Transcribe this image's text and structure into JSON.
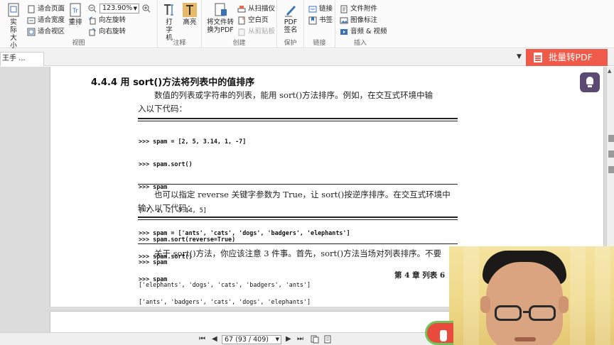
{
  "ribbon": {
    "view": {
      "actual_size": "实际大小",
      "fit_page": "适合页面",
      "fit_width": "适合宽度",
      "fit_view": "适合视区",
      "reflow": "重排",
      "zoom": "123.90%",
      "rotate_left": "向左旋转",
      "rotate_right": "向右旋转",
      "label": "视图"
    },
    "annotate": {
      "typewriter": "打字机",
      "highlight": "高亮",
      "label": "注释"
    },
    "create": {
      "convert": "将文件转换为PDF",
      "from_scanner": "从扫描仪",
      "blank_page": "空白页",
      "from_clipboard": "从剪贴板",
      "label": "创建"
    },
    "protect": {
      "pdf_sign": "PDF签名",
      "label": "保护"
    },
    "links": {
      "link": "链接",
      "bookmark": "书签",
      "label": "链接"
    },
    "insert": {
      "attachment": "文件附件",
      "image_annot": "图像标注",
      "audio_video": "音频 & 视频",
      "label": "插入"
    }
  },
  "tabs": {
    "doc_tab": "王手 ..."
  },
  "batch_pdf": "批量转PDF",
  "document": {
    "section_title": "4.4.4   用 sort()方法将列表中的值排序",
    "para1_line1": "数值的列表或字符串的列表，能用 sort()方法排序。例如，在交互式环境中输",
    "para1_line2": "入以下代码：",
    "code1": [
      ">>> spam = [2, 5, 3.14, 1, -7]",
      ">>> spam.sort()",
      ">>> spam",
      "[-7, 1, 2, 3.14, 5]",
      ">>> spam = ['ants', 'cats', 'dogs', 'badgers', 'elephants']",
      ">>> spam.sort()",
      ">>> spam",
      "['ants', 'badgers', 'cats', 'dogs', 'elephants']"
    ],
    "para2_line1": "也可以指定 reverse 关键字参数为 True，让 sort()按逆序排序。在交互式环境中",
    "para2_line2": "输入以下代码：",
    "code2": [
      ">>> spam.sort(reverse=True)",
      ">>> spam",
      "['elephants', 'dogs', 'cats', 'badgers', 'ants']"
    ],
    "para3_line1": "关于 sort()方法，你应该注意 3 件事。首先，sort()方法当场对列表排序。不要",
    "footer": "第 4 章    列表    6"
  },
  "status": {
    "page_indicator": "67 (93 / 409)",
    "first": "⏮",
    "prev": "◀",
    "next": "▶",
    "last": "⏭"
  },
  "colors": {
    "batch_btn": "#f05a4a",
    "highlight_icon": "#e8b96a",
    "bulb": "#5c4a72"
  }
}
